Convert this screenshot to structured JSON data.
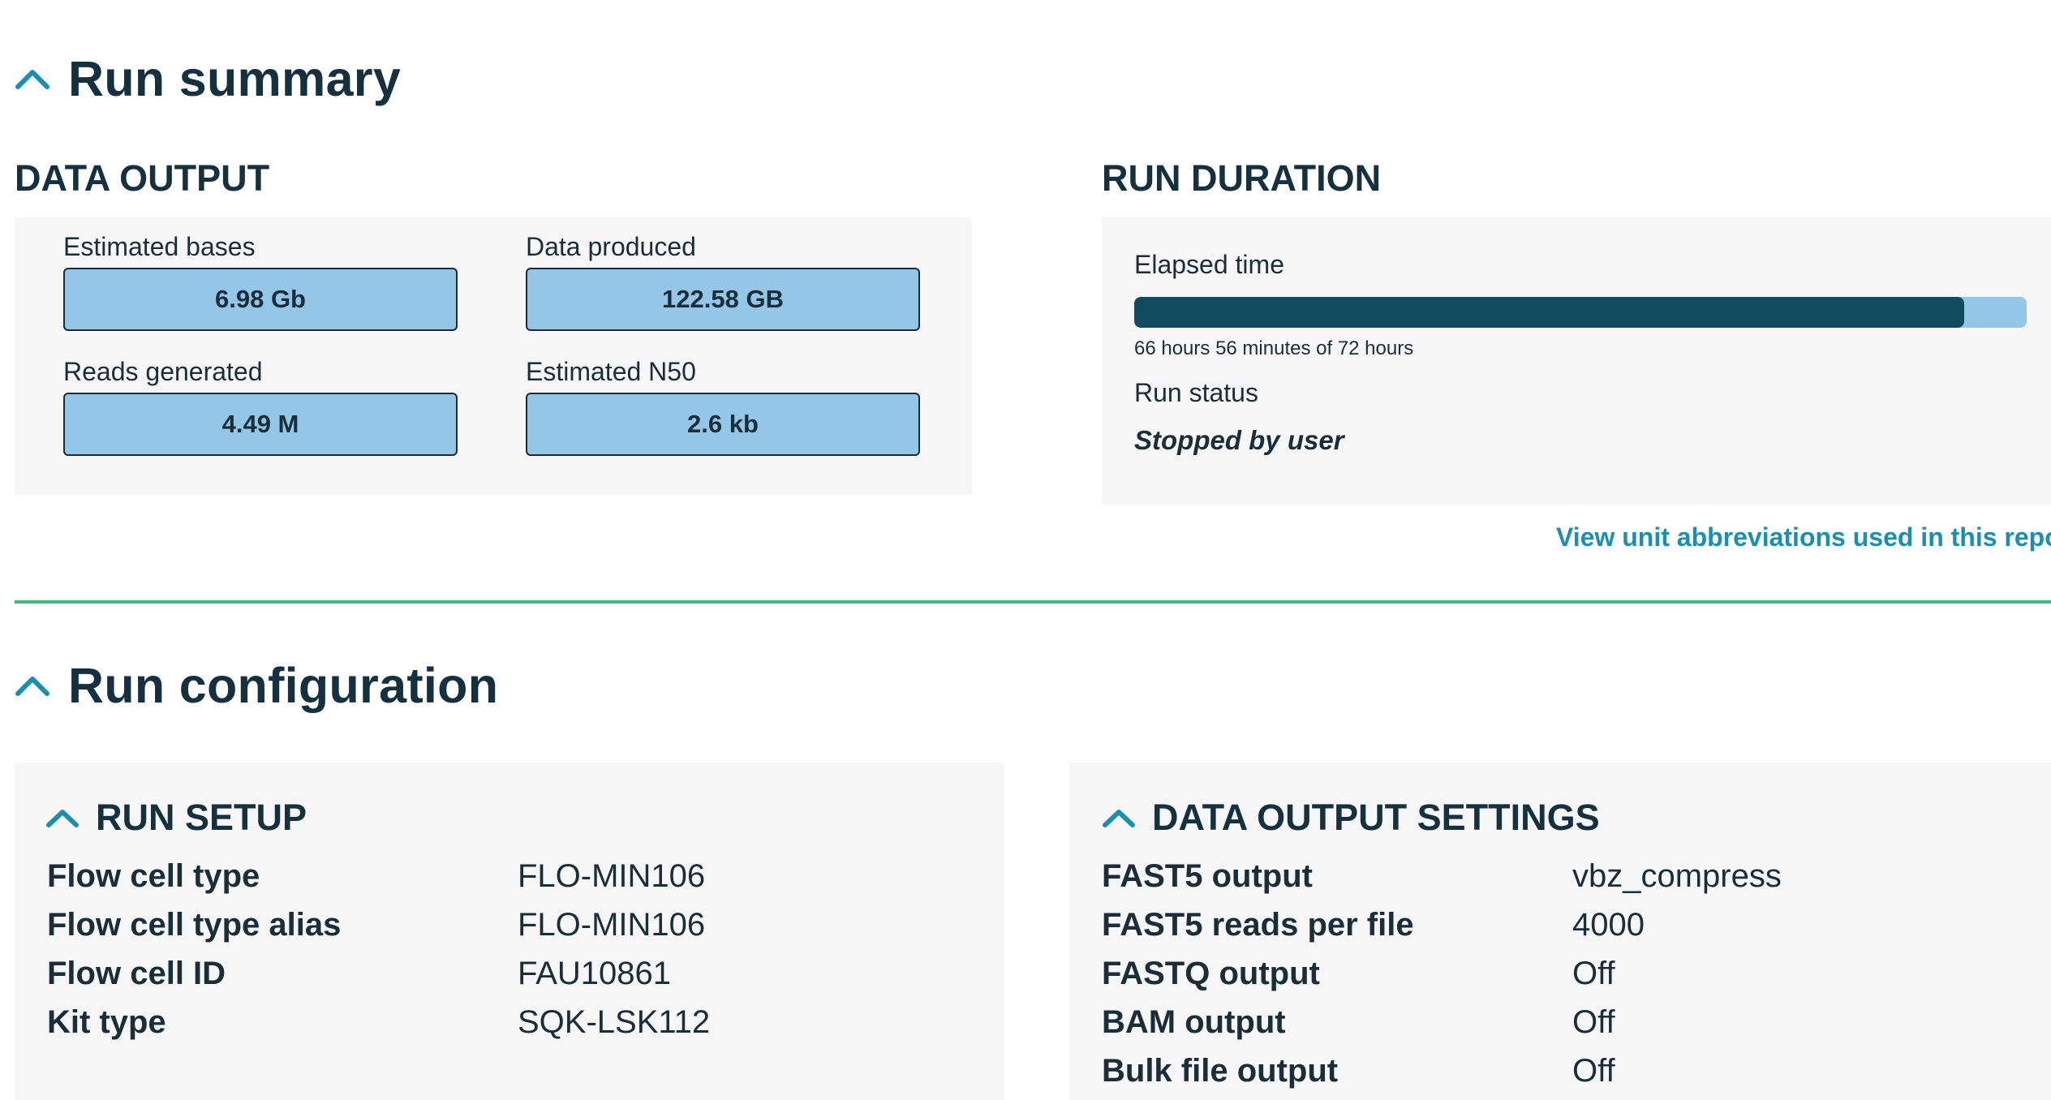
{
  "run_summary": {
    "title": "Run summary",
    "data_output": {
      "heading": "DATA OUTPUT",
      "stats": [
        {
          "label": "Estimated bases",
          "value": "6.98 Gb"
        },
        {
          "label": "Data produced",
          "value": "122.58 GB"
        },
        {
          "label": "Reads generated",
          "value": "4.49 M"
        },
        {
          "label": "Estimated N50",
          "value": "2.6 kb"
        }
      ]
    },
    "run_duration": {
      "heading": "RUN DURATION",
      "elapsed_label": "Elapsed time",
      "elapsed_text": "66 hours 56 minutes of 72 hours",
      "progress_fraction": 0.93,
      "status_label": "Run status",
      "status_value": "Stopped by user"
    },
    "abbreviations_link": "View unit abbreviations used in this repor"
  },
  "run_configuration": {
    "title": "Run configuration",
    "run_setup": {
      "heading": "RUN SETUP",
      "rows": [
        {
          "key": "Flow cell type",
          "value": "FLO-MIN106"
        },
        {
          "key": "Flow cell type alias",
          "value": "FLO-MIN106"
        },
        {
          "key": "Flow cell ID",
          "value": "FAU10861"
        },
        {
          "key": "Kit type",
          "value": "SQK-LSK112"
        }
      ]
    },
    "data_output_settings": {
      "heading": "DATA OUTPUT SETTINGS",
      "rows": [
        {
          "key": "FAST5 output",
          "value": "vbz_compress"
        },
        {
          "key": "FAST5 reads per file",
          "value": "4000"
        },
        {
          "key": "FASTQ output",
          "value": "Off"
        },
        {
          "key": "BAM output",
          "value": "Off"
        },
        {
          "key": "Bulk file output",
          "value": "Off"
        }
      ]
    }
  },
  "icons": {
    "collapse": "chevron-up-icon"
  },
  "colors": {
    "accent": "#1a8fb0",
    "stat_box": "#93c6e7",
    "progress_fill": "#104a5e",
    "divider": "#3dbb7a",
    "panel_bg": "#f6f6f6"
  }
}
